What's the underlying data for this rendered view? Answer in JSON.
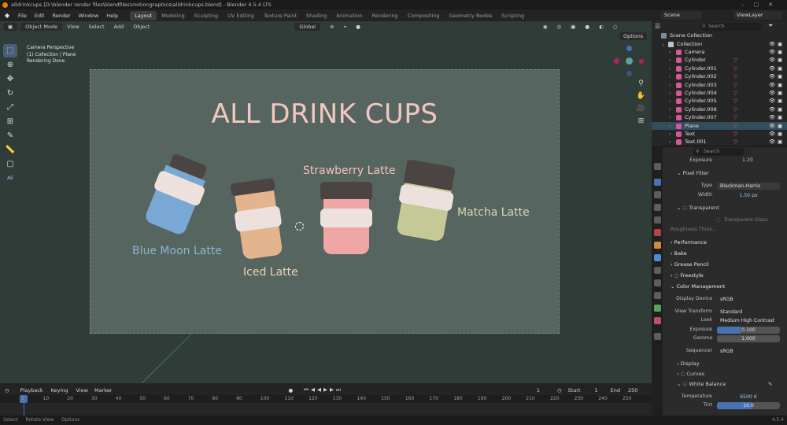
{
  "window": {
    "title": "alldrinkcups [D:\\blender render files\\blendfiles\\motiongraphics\\alldrinkcups.blend] - Blender 4.5.4 LTS"
  },
  "menu": [
    "File",
    "Edit",
    "Render",
    "Window",
    "Help"
  ],
  "workspaces": [
    "Layout",
    "Modeling",
    "Sculpting",
    "UV Editing",
    "Texture Paint",
    "Shading",
    "Animation",
    "Rendering",
    "Compositing",
    "Geometry Nodes",
    "Scripting"
  ],
  "active_workspace": "Layout",
  "scene": {
    "name": "Scene",
    "view_layer": "ViewLayer"
  },
  "viewport": {
    "mode": "Object Mode",
    "menus": [
      "View",
      "Select",
      "Add",
      "Object"
    ],
    "orientation": "Global",
    "options_label": "Options",
    "overlay_lines": [
      "Camera Perspective",
      "(1) Collection | Plane",
      "Rendering Done"
    ],
    "side_label": "AE"
  },
  "render": {
    "title": "ALL DRINK CUPS",
    "labels": {
      "blue": "Blue Moon Latte",
      "iced": "Iced Latte",
      "strawberry": "Strawberry Latte",
      "matcha": "Matcha Latte"
    }
  },
  "colors": {
    "blue_cup": "#7aa8d4",
    "iced_cup": "#e3b48e",
    "straw_cup": "#f0a6a4",
    "matcha_cup": "#c4c996",
    "lid": "#4a4542",
    "sleeve": "#ece1dc",
    "title": "#f0c8c0",
    "accent": "#4772b3"
  },
  "outliner": {
    "search_placeholder": "Search",
    "header": "Scene Collection",
    "items": [
      {
        "name": "Collection",
        "icon": "collection-icon",
        "indent": 1
      },
      {
        "name": "Camera",
        "icon": "camera-icon",
        "indent": 2
      },
      {
        "name": "Cylinder",
        "icon": "mesh-icon",
        "indent": 2
      },
      {
        "name": "Cylinder.001",
        "icon": "mesh-icon",
        "indent": 2
      },
      {
        "name": "Cylinder.002",
        "icon": "mesh-icon",
        "indent": 2
      },
      {
        "name": "Cylinder.003",
        "icon": "mesh-icon",
        "indent": 2
      },
      {
        "name": "Cylinder.004",
        "icon": "mesh-icon",
        "indent": 2
      },
      {
        "name": "Cylinder.005",
        "icon": "mesh-icon",
        "indent": 2
      },
      {
        "name": "Cylinder.006",
        "icon": "mesh-icon",
        "indent": 2
      },
      {
        "name": "Cylinder.007",
        "icon": "mesh-icon",
        "indent": 2
      },
      {
        "name": "Plane",
        "icon": "mesh-icon",
        "indent": 2,
        "selected": true
      },
      {
        "name": "Text",
        "icon": "text-icon",
        "indent": 2
      },
      {
        "name": "Text.001",
        "icon": "text-icon",
        "indent": 2
      }
    ]
  },
  "properties": {
    "search_placeholder": "Search",
    "exposure_top": {
      "label": "Exposure",
      "value": "1.20"
    },
    "pixel_filter": "Pixel Filter",
    "type": {
      "label": "Type",
      "value": "Blackman-Harris"
    },
    "width": {
      "label": "Width",
      "value": "1.50 px"
    },
    "transparent": "Transparent",
    "transparent_glass": "Transparent Glass",
    "roughness": "Roughness Thres...",
    "sections": [
      "Performance",
      "Bake",
      "Grease Pencil",
      "Freestyle",
      "Color Management"
    ],
    "display_device": {
      "label": "Display Device",
      "value": "sRGB"
    },
    "view_transform": {
      "label": "View Transform",
      "value": "Standard"
    },
    "look": {
      "label": "Look",
      "value": "Medium High Contrast"
    },
    "exposure": {
      "label": "Exposure",
      "value": "0.100",
      "fill": 0.38
    },
    "gamma": {
      "label": "Gamma",
      "value": "1.000"
    },
    "sequencer": {
      "label": "Sequencer",
      "value": "sRGB"
    },
    "display": "Display",
    "curves": "Curves",
    "white_balance": "White Balance",
    "temperature": {
      "label": "Temperature",
      "value": "6500 K"
    },
    "tint": {
      "label": "Tint",
      "value": "10.0",
      "fill": 0.55
    }
  },
  "timeline": {
    "menus": [
      "Playback",
      "Keying",
      "View",
      "Marker"
    ],
    "current_frame": "1",
    "start_label": "Start",
    "start": "1",
    "end_label": "End",
    "end": "250",
    "ticks": [
      "1",
      "10",
      "20",
      "30",
      "40",
      "50",
      "60",
      "70",
      "80",
      "90",
      "100",
      "110",
      "120",
      "130",
      "140",
      "150",
      "160",
      "170",
      "180",
      "190",
      "200",
      "210",
      "220",
      "230",
      "240",
      "250"
    ]
  },
  "status": {
    "items": [
      "Select",
      "Rotate View",
      "Options"
    ],
    "version": "4.5.4"
  }
}
